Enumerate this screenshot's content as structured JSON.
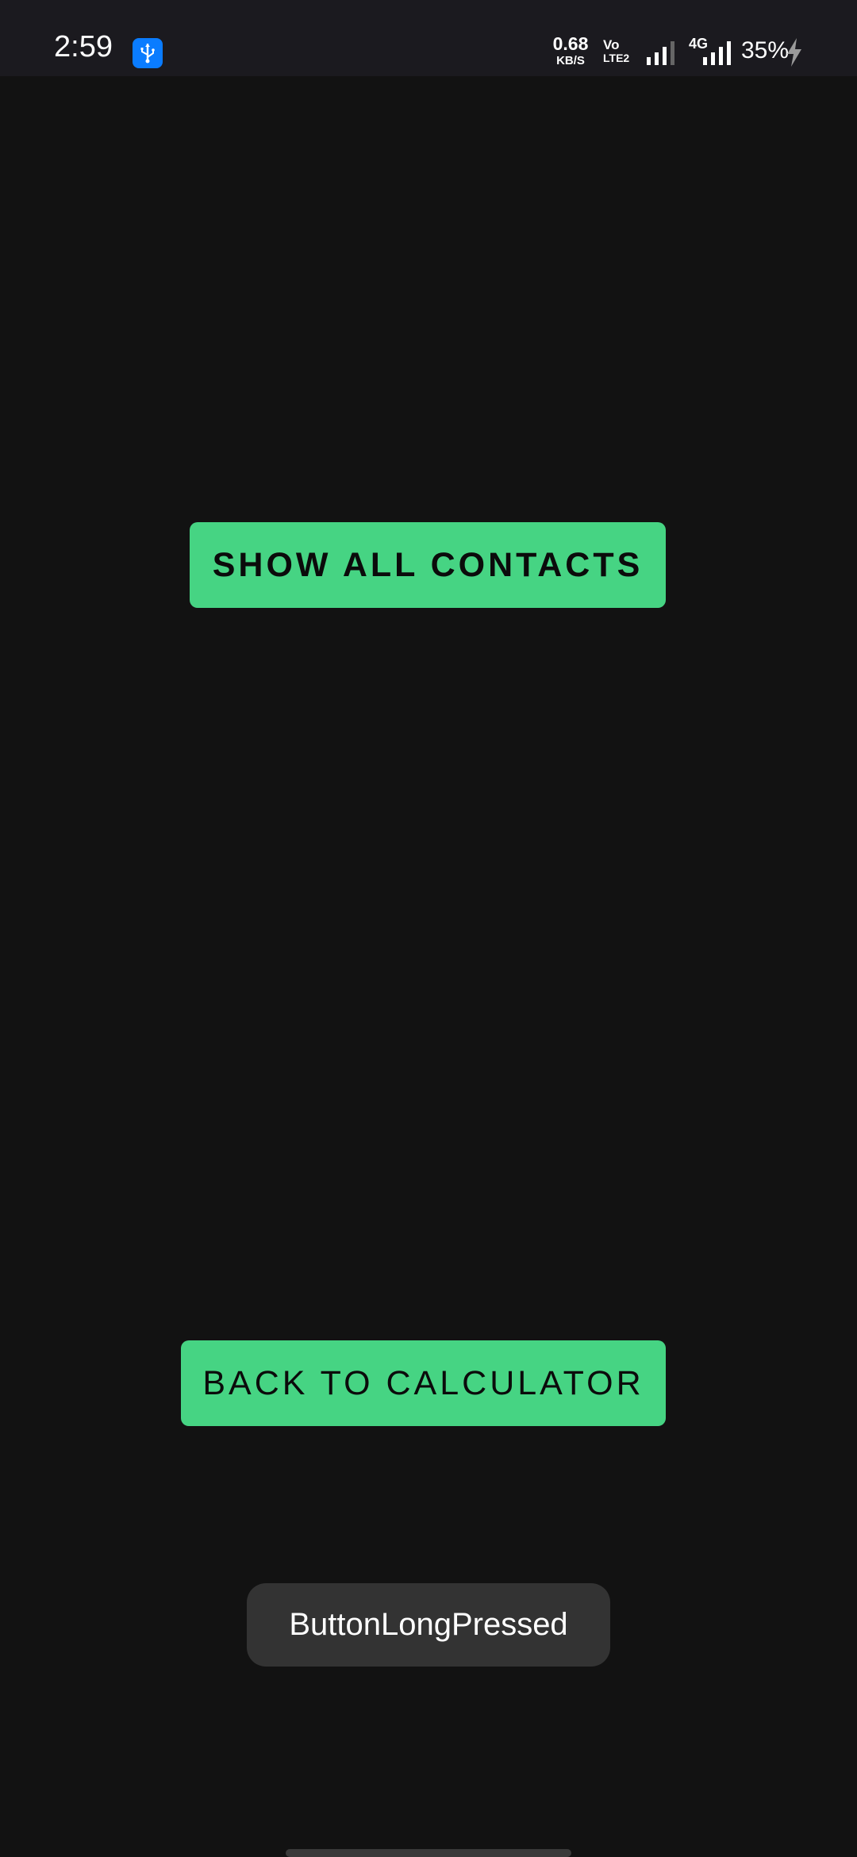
{
  "status_bar": {
    "time": "2:59",
    "usb_icon": "usb-icon",
    "net_speed_value": "0.68",
    "net_speed_unit": "KB/S",
    "volte_top": "Vo",
    "volte_bottom": "LTE2",
    "network_type": "4G",
    "battery_percent": "35%",
    "charging_icon": "bolt-icon",
    "colors": {
      "background": "#1b1a1f",
      "usb_badge": "#0a7cff",
      "text": "#ffffff"
    }
  },
  "main": {
    "show_contacts_label": "SHOW ALL CONTACTS",
    "back_to_calculator_label": "BACK TO CALCULATOR",
    "button_color": "#46d483",
    "background_color": "#121212"
  },
  "toast": {
    "message": "ButtonLongPressed"
  }
}
